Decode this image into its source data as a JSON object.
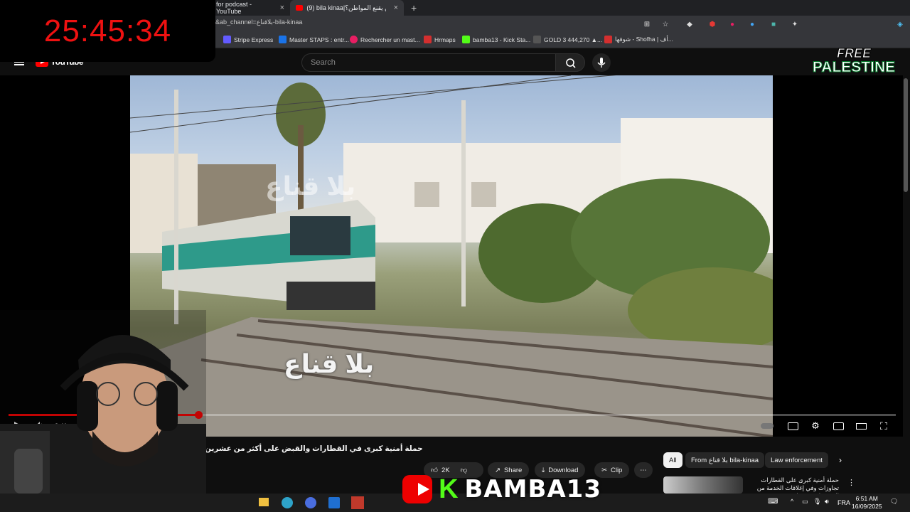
{
  "timer": {
    "value": "25:45:34"
  },
  "tabs": [
    {
      "label": "for podcast - YouTube"
    },
    {
      "label": "(9) bila kinaa|‏هل من يقنع المواطن؟"
    }
  ],
  "address_bar": {
    "url": "&ab_channel=بلاقناع-bila-kinaa"
  },
  "bookmarks": [
    {
      "label": "Stripe Express",
      "color": "#635bff"
    },
    {
      "label": "Master STAPS : entr...",
      "color": "#1a73e8"
    },
    {
      "label": "Rechercher un mast...",
      "color": "#e91e63"
    },
    {
      "label": "Hrmaps",
      "color": "#d32f2f"
    },
    {
      "label": "bamba13 - Kick Sta...",
      "color": "#53fc18"
    },
    {
      "label": "GOLD 3 444,270 ▲...",
      "color": "#222222"
    },
    {
      "label": "شوفها - Shofha | أف...",
      "color": "#d32f2f"
    }
  ],
  "youtube": {
    "logo_text": "YouTube",
    "search": {
      "placeholder": "Search",
      "value": ""
    }
  },
  "overlay": {
    "free_palestine": {
      "line1": "FREE",
      "line2": "PALESTINE"
    },
    "stream_banner": {
      "name": "BAMBA13"
    }
  },
  "video": {
    "watermark": "بلا قناع",
    "subtitle": "بلا قناع",
    "current_time": "2:41",
    "progress": 0.214,
    "title": "حملة أمنية كبرى في القطارات والقبض على أكثر من عشرين"
  },
  "actions": [
    {
      "id": "like",
      "label": "2K",
      "icon": "thumbs-up-icon"
    },
    {
      "id": "share",
      "label": "Share",
      "icon": "share-icon"
    },
    {
      "id": "download",
      "label": "Download",
      "icon": "download-icon"
    },
    {
      "id": "clip",
      "label": "Clip",
      "icon": "scissors-icon"
    }
  ],
  "chips": [
    {
      "label": "All"
    },
    {
      "label": "From بلا قناع bila-kinaa"
    },
    {
      "label": "Law enforcement"
    }
  ],
  "recommendation": {
    "title": "حملة أمنية كبرى على القطارات تجاوزات وفي إغلاقات الخدمة من المسؤول عن هذا"
  },
  "taskbar": {
    "language": "FRA",
    "time": "6:51 AM",
    "date": "16/09/2025"
  },
  "colors": {
    "accent_red": "#ff0000",
    "timer_red": "#ee1111",
    "kick_green": "#53fc18",
    "background": "#0f0f0f"
  }
}
